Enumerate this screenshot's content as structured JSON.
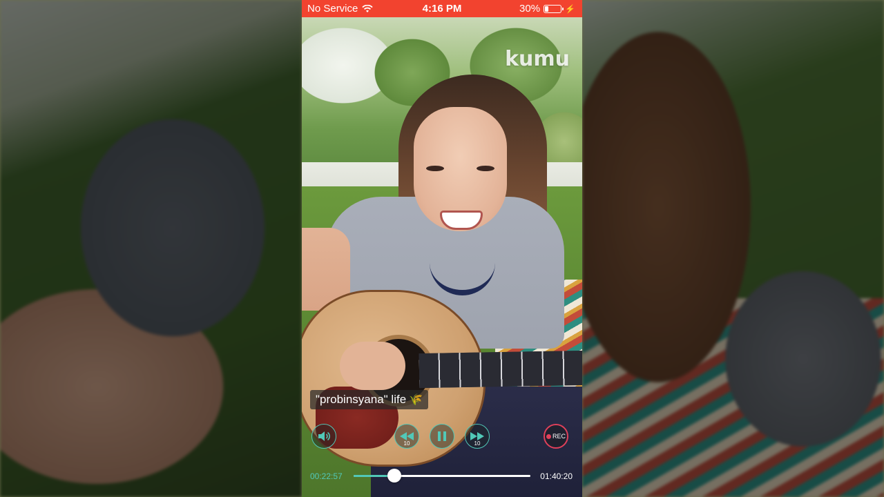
{
  "status_bar": {
    "carrier": "No Service",
    "time": "4:16 PM",
    "battery_percent": "30%",
    "battery_level": 0.3,
    "icons": [
      "wifi-icon",
      "battery-icon",
      "charging-bolt-icon"
    ]
  },
  "stream": {
    "watermark": "kumu",
    "caption": "\"probinsyana\" life",
    "caption_emoji": "🌾"
  },
  "controls": {
    "volume_icon": "volume-icon",
    "rewind_icon": "rewind-10-icon",
    "rewind_label": "10",
    "pause_icon": "pause-icon",
    "forward_icon": "forward-10-icon",
    "forward_label": "10",
    "rec_label": "REC"
  },
  "playback": {
    "elapsed": "00:22:57",
    "total": "01:40:20",
    "progress": 0.23
  },
  "colors": {
    "status_bar": "#f2432f",
    "accent": "#51c8b8",
    "rec": "#e0405a"
  }
}
